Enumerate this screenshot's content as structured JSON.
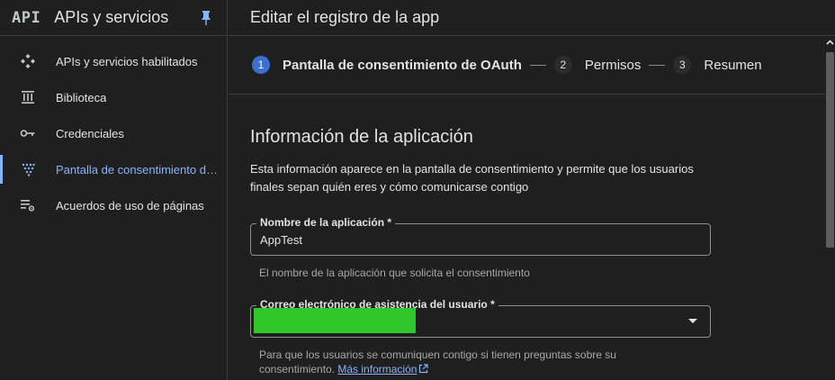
{
  "sidebar": {
    "logo": "API",
    "title": "APIs y servicios",
    "items": [
      {
        "label": "APIs y servicios habilitados",
        "icon": "apis-diamond-icon"
      },
      {
        "label": "Biblioteca",
        "icon": "library-icon"
      },
      {
        "label": "Credenciales",
        "icon": "key-icon"
      },
      {
        "label": "Pantalla de consentimiento de OAuth",
        "icon": "consent-dots-icon",
        "active": true
      },
      {
        "label": "Acuerdos de uso de páginas",
        "icon": "settings-list-icon"
      }
    ]
  },
  "header": {
    "title": "Editar el registro de la app"
  },
  "stepper": {
    "steps": [
      {
        "num": "1",
        "label": "Pantalla de consentimiento de OAuth",
        "active": true
      },
      {
        "num": "2",
        "label": "Permisos"
      },
      {
        "num": "3",
        "label": "Resumen"
      }
    ]
  },
  "form": {
    "section_title": "Información de la aplicación",
    "section_desc": "Esta información aparece en la pantalla de consentimiento y permite que los usuarios finales sepan quién eres y cómo comunicarse contigo",
    "app_name": {
      "label": "Nombre de la aplicación *",
      "value": "AppTest",
      "hint": "El nombre de la aplicación que solicita el consentimiento"
    },
    "support_email": {
      "label": "Correo electrónico de asistencia del usuario *",
      "hint": "Para que los usuarios se comuniquen contigo si tienen preguntas sobre su consentimiento.",
      "link": "Más información"
    }
  },
  "colors": {
    "accent": "#8ab4f8",
    "step_active": "#3b6fd1",
    "redaction": "#2fc72a",
    "background": "#1f1f1f"
  }
}
